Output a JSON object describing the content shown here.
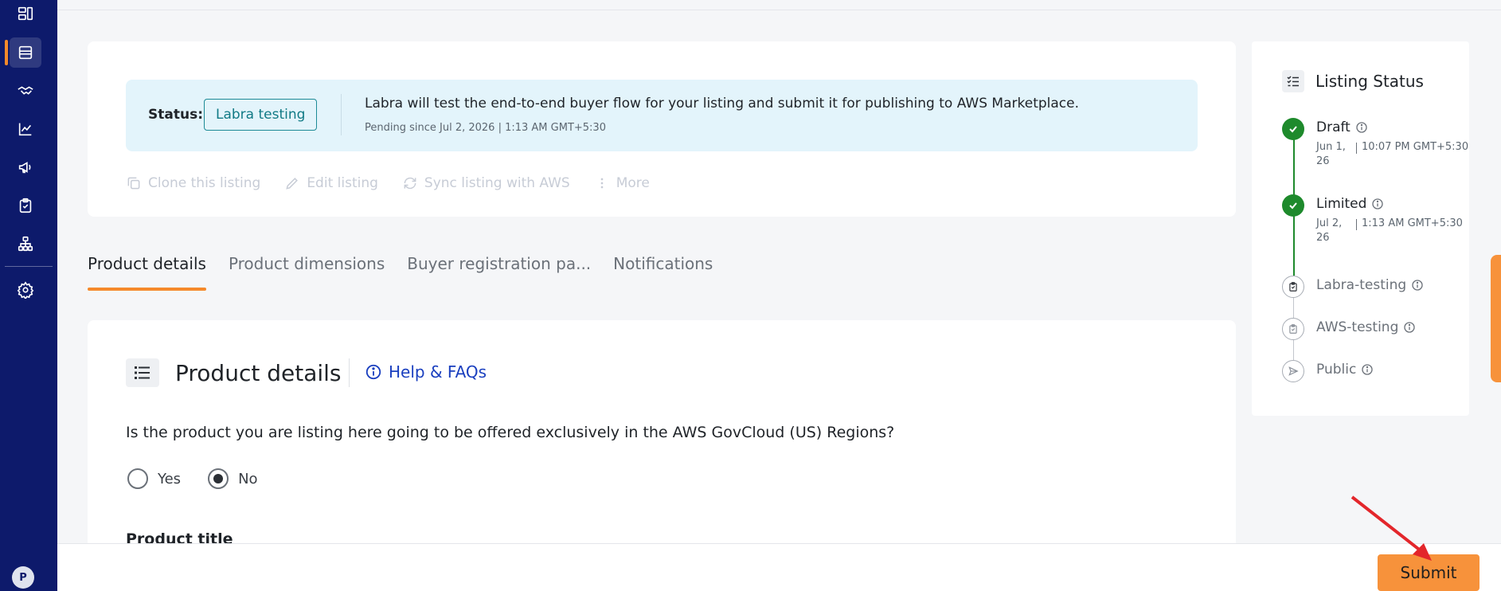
{
  "sidebar": {
    "items": [
      {
        "icon": "dashboard-icon",
        "active": false
      },
      {
        "icon": "storefront-icon",
        "active": true
      },
      {
        "icon": "handshake-icon",
        "active": false
      },
      {
        "icon": "analytics-chart-icon",
        "active": false
      },
      {
        "icon": "megaphone-icon",
        "active": false
      },
      {
        "icon": "clipboard-check-icon",
        "active": false
      },
      {
        "icon": "hierarchy-icon",
        "active": false
      },
      {
        "icon": "gear-icon",
        "active": false
      }
    ],
    "avatar_initial": "P"
  },
  "status_card": {
    "label": "Status:",
    "badge": "Labra testing",
    "message": "Labra will test the end-to-end buyer flow for your listing and submit it for publishing to AWS Marketplace.",
    "pending_since": "Pending since Jul 2, 2026 | 1:13 AM GMT+5:30",
    "actions": [
      {
        "label": "Clone this listing",
        "icon": "copy-icon"
      },
      {
        "label": "Edit listing",
        "icon": "pencil-icon"
      },
      {
        "label": "Sync listing with AWS",
        "icon": "sync-icon"
      },
      {
        "label": "More",
        "icon": "more-vertical-icon"
      }
    ]
  },
  "tabs": [
    {
      "label": "Product details",
      "active": true
    },
    {
      "label": "Product dimensions",
      "active": false
    },
    {
      "label": "Buyer registration pa...",
      "active": false
    },
    {
      "label": "Notifications",
      "active": false
    }
  ],
  "product_details": {
    "title": "Product details",
    "help_link": "Help & FAQs",
    "question": "Is the product you are listing here going to be offered exclusively in the AWS GovCloud (US) Regions?",
    "options": [
      {
        "label": "Yes",
        "selected": false
      },
      {
        "label": "No",
        "selected": true
      }
    ],
    "next_field_label": "Product title"
  },
  "listing_status": {
    "title": "Listing Status",
    "steps": [
      {
        "name": "Draft",
        "state": "done",
        "date": "Jun 1, 26",
        "time": "10:07 PM GMT+5:30"
      },
      {
        "name": "Limited",
        "state": "done",
        "date": "Jul 2, 26",
        "time": "1:13 AM GMT+5:30"
      },
      {
        "name": "Labra-testing",
        "state": "pending",
        "icon": "clipboard-check-icon"
      },
      {
        "name": "AWS-testing",
        "state": "pending",
        "icon": "clipboard-check-icon"
      },
      {
        "name": "Public",
        "state": "pending",
        "icon": "send-icon"
      }
    ]
  },
  "footer": {
    "submit_label": "Submit"
  },
  "colors": {
    "sidebar": "#0d1a6b",
    "accent_orange": "#f5892b",
    "success_green": "#1e8a2c",
    "teal_badge": "#117a85",
    "link_blue": "#1a3fbf",
    "banner_bg": "#e3f4fb",
    "annotation_arrow": "#e3262b"
  }
}
